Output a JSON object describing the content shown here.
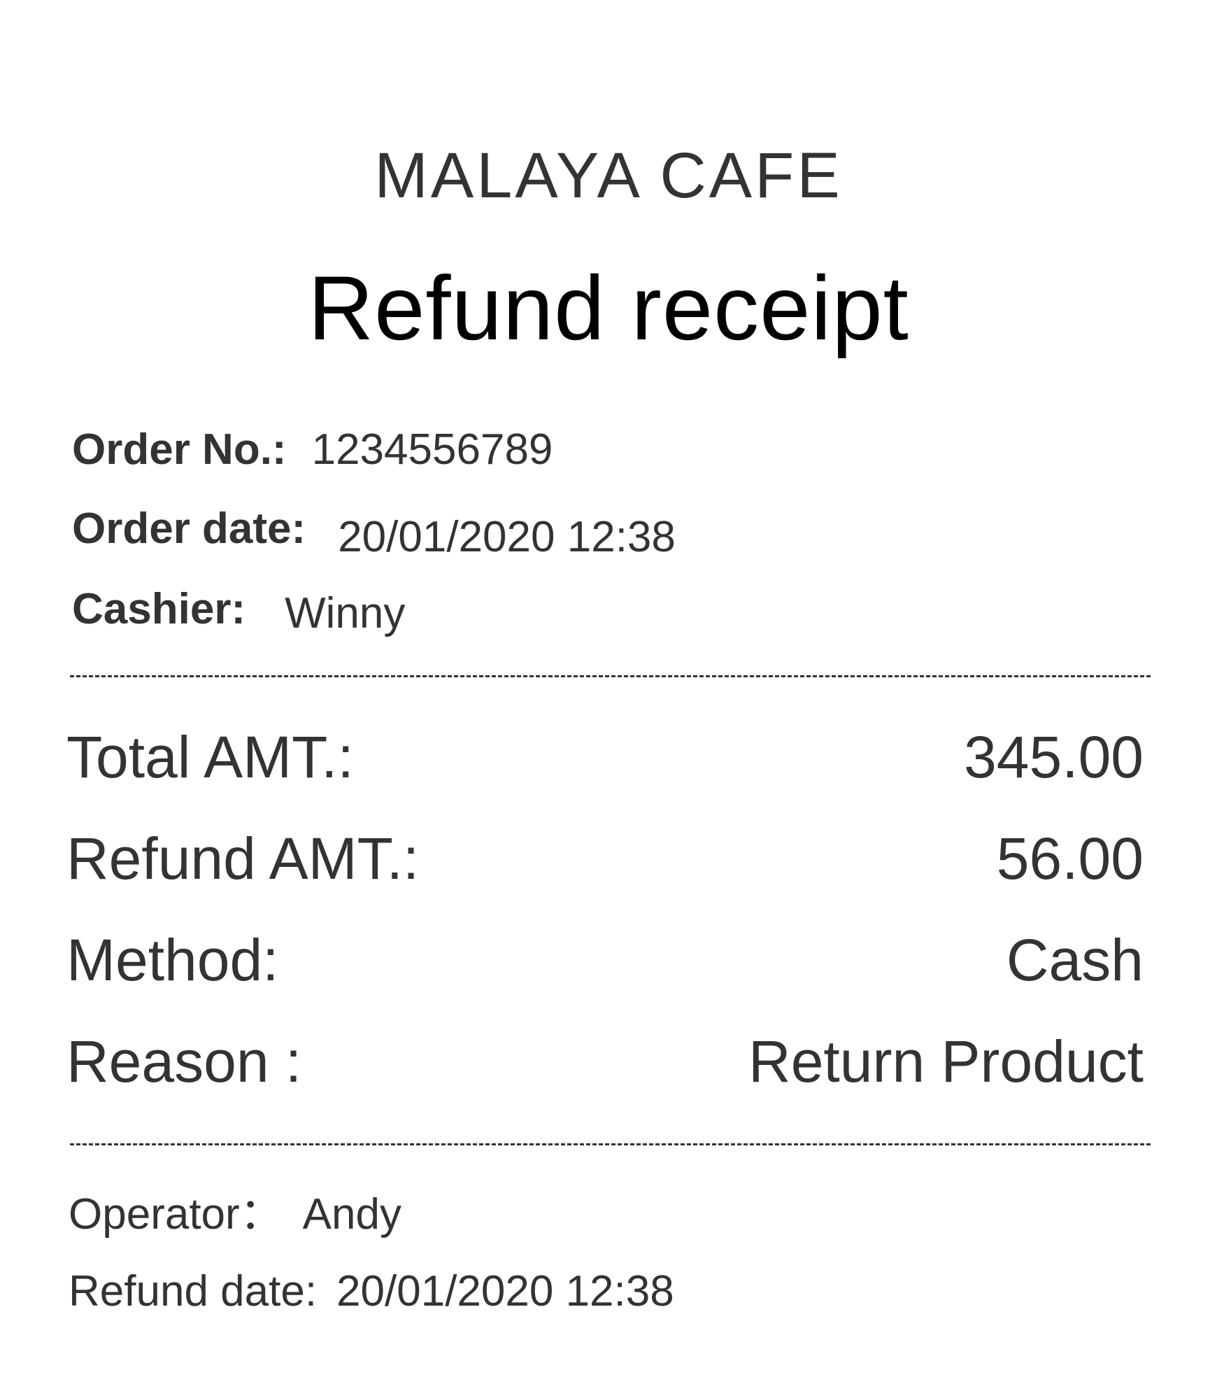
{
  "header": {
    "store_name": "MALAYA CAFE",
    "title": "Refund receipt"
  },
  "order_info": {
    "order_no_label": "Order No.:",
    "order_no": "1234556789",
    "order_date_label": "Order date:",
    "order_date": "20/01/2020 12:38",
    "cashier_label": "Cashier:",
    "cashier": "Winny"
  },
  "amounts": {
    "total_label": "Total AMT.:",
    "total": "345.00",
    "refund_label": "Refund AMT.:",
    "refund": "56.00",
    "method_label": "Method:",
    "method": "Cash",
    "reason_label": "Reason :",
    "reason": "Return Product"
  },
  "footer": {
    "operator_label": "Operator：",
    "operator": "Andy",
    "refund_date_label": "Refund date:",
    "refund_date": "20/01/2020 12:38"
  }
}
